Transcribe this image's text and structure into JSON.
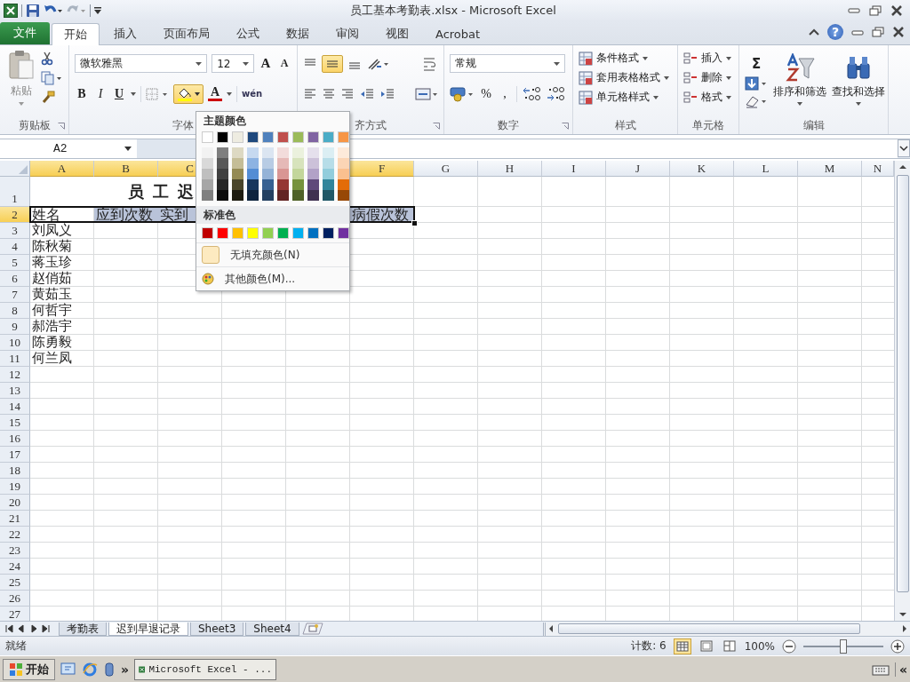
{
  "window": {
    "title": "员工基本考勤表.xlsx - Microsoft Excel",
    "help": "?"
  },
  "ribbon_tabs": [
    {
      "label": "文件",
      "kind": "file",
      "selected": false
    },
    {
      "label": "开始",
      "kind": "tab",
      "selected": true
    },
    {
      "label": "插入",
      "kind": "tab",
      "selected": false
    },
    {
      "label": "页面布局",
      "kind": "tab",
      "selected": false
    },
    {
      "label": "公式",
      "kind": "tab",
      "selected": false
    },
    {
      "label": "数据",
      "kind": "tab",
      "selected": false
    },
    {
      "label": "审阅",
      "kind": "tab",
      "selected": false
    },
    {
      "label": "视图",
      "kind": "tab",
      "selected": false
    },
    {
      "label": "Acrobat",
      "kind": "tab",
      "selected": false
    }
  ],
  "ribbon": {
    "clipboard": {
      "paste": "粘贴",
      "group": "剪贴板"
    },
    "font": {
      "name": "微软雅黑",
      "size": "12",
      "grow": "A",
      "shrink": "A",
      "bold": "B",
      "italic": "I",
      "underline": "U",
      "font_color": "A",
      "phonetic": "wén",
      "fill_pressed": true,
      "group": "字体"
    },
    "alignment": {
      "middle_pressed": true,
      "group": "齐方式"
    },
    "number": {
      "format": "常规",
      "percent": "%",
      "comma": ",",
      "group": "数字"
    },
    "styles": {
      "items": [
        "条件格式",
        "套用表格格式",
        "单元格样式"
      ],
      "group": "样式"
    },
    "cells": {
      "items": [
        "插入",
        "删除",
        "格式"
      ],
      "group": "单元格"
    },
    "editing": {
      "sum": "Σ",
      "sort": "排序和筛选",
      "find": "查找和选择",
      "group": "编辑"
    }
  },
  "name_box": "A2",
  "sheet": {
    "columns": [
      {
        "kind": "header",
        "label": "A",
        "selected": true
      },
      {
        "kind": "header",
        "label": "B",
        "selected": true
      },
      {
        "kind": "header",
        "label": "C",
        "selected": true
      },
      {
        "kind": "covered"
      },
      {
        "kind": "covered"
      },
      {
        "kind": "header",
        "label": "F",
        "selected": true
      },
      {
        "kind": "header",
        "label": "G",
        "selected": false
      },
      {
        "kind": "header",
        "label": "H",
        "selected": false
      },
      {
        "kind": "header",
        "label": "I",
        "selected": false
      },
      {
        "kind": "header",
        "label": "J",
        "selected": false
      },
      {
        "kind": "header",
        "label": "K",
        "selected": false
      },
      {
        "kind": "header",
        "label": "L",
        "selected": false
      },
      {
        "kind": "header",
        "label": "M",
        "selected": false
      },
      {
        "kind": "header",
        "label": "N",
        "selected": false
      }
    ],
    "rows": [
      {
        "number": "1",
        "selected": false,
        "kind": "title",
        "text": "员工迟"
      },
      {
        "number": "2",
        "selected": true,
        "kind": "header",
        "cells": [
          {
            "kind": "text",
            "text": "姓名",
            "highlighted": false
          },
          {
            "kind": "text",
            "text": "应到次数",
            "highlighted": true
          },
          {
            "kind": "text",
            "text": "实到",
            "highlighted": true
          },
          {
            "kind": "covered"
          },
          {
            "kind": "covered"
          },
          {
            "kind": "text",
            "text": "病假次数",
            "highlighted": true
          }
        ]
      },
      {
        "number": "3",
        "selected": false,
        "kind": "data",
        "cells": [
          {
            "kind": "text",
            "text": "刘凤义"
          }
        ]
      },
      {
        "number": "4",
        "selected": false,
        "kind": "data",
        "cells": [
          {
            "kind": "text",
            "text": "陈秋菊"
          }
        ]
      },
      {
        "number": "5",
        "selected": false,
        "kind": "data",
        "cells": [
          {
            "kind": "text",
            "text": "蒋玉珍"
          }
        ]
      },
      {
        "number": "6",
        "selected": false,
        "kind": "data",
        "cells": [
          {
            "kind": "text",
            "text": "赵俏茹"
          }
        ]
      },
      {
        "number": "7",
        "selected": false,
        "kind": "data",
        "cells": [
          {
            "kind": "text",
            "text": "黄茹玉"
          }
        ]
      },
      {
        "number": "8",
        "selected": false,
        "kind": "data",
        "cells": [
          {
            "kind": "text",
            "text": "何哲宇"
          }
        ]
      },
      {
        "number": "9",
        "selected": false,
        "kind": "data",
        "cells": [
          {
            "kind": "text",
            "text": "郝浩宇"
          }
        ]
      },
      {
        "number": "10",
        "selected": false,
        "kind": "data",
        "cells": [
          {
            "kind": "text",
            "text": "陈勇毅"
          }
        ]
      },
      {
        "number": "11",
        "selected": false,
        "kind": "data",
        "cells": [
          {
            "kind": "text",
            "text": "何兰凤"
          }
        ]
      },
      {
        "number": "12",
        "selected": false,
        "kind": "data",
        "cells": []
      },
      {
        "number": "13",
        "selected": false,
        "kind": "data",
        "cells": []
      },
      {
        "number": "14",
        "selected": false,
        "kind": "data",
        "cells": []
      },
      {
        "number": "15",
        "selected": false,
        "kind": "data",
        "cells": []
      },
      {
        "number": "16",
        "selected": false,
        "kind": "data",
        "cells": []
      },
      {
        "number": "17",
        "selected": false,
        "kind": "data",
        "cells": []
      },
      {
        "number": "18",
        "selected": false,
        "kind": "data",
        "cells": []
      },
      {
        "number": "19",
        "selected": false,
        "kind": "data",
        "cells": []
      },
      {
        "number": "20",
        "selected": false,
        "kind": "data",
        "cells": []
      },
      {
        "number": "21",
        "selected": false,
        "kind": "data",
        "cells": []
      },
      {
        "number": "22",
        "selected": false,
        "kind": "data",
        "cells": []
      },
      {
        "number": "23",
        "selected": false,
        "kind": "data",
        "cells": []
      },
      {
        "number": "24",
        "selected": false,
        "kind": "data",
        "cells": []
      },
      {
        "number": "25",
        "selected": false,
        "kind": "data",
        "cells": []
      },
      {
        "number": "26",
        "selected": false,
        "kind": "data",
        "cells": []
      },
      {
        "number": "27",
        "selected": false,
        "kind": "data",
        "cells": []
      }
    ]
  },
  "fill_menu": {
    "theme_header": "主题颜色",
    "theme": [
      {
        "color": "#ffffff",
        "shades": [
          {
            "color": "#f2f2f2"
          },
          {
            "color": "#d9d9d9"
          },
          {
            "color": "#bfbfbf"
          },
          {
            "color": "#a6a6a6"
          },
          {
            "color": "#808080"
          }
        ]
      },
      {
        "color": "#000000",
        "shades": [
          {
            "color": "#7f7f7f"
          },
          {
            "color": "#595959"
          },
          {
            "color": "#404040"
          },
          {
            "color": "#262626"
          },
          {
            "color": "#0d0d0d"
          }
        ]
      },
      {
        "color": "#eeece1",
        "shades": [
          {
            "color": "#ddd9c3"
          },
          {
            "color": "#c4bd97"
          },
          {
            "color": "#948a54"
          },
          {
            "color": "#4a452a"
          },
          {
            "color": "#1e1c11"
          }
        ]
      },
      {
        "color": "#1f497d",
        "shades": [
          {
            "color": "#c6d9f0"
          },
          {
            "color": "#8db3e2"
          },
          {
            "color": "#548dd4"
          },
          {
            "color": "#17365d"
          },
          {
            "color": "#0f243e"
          }
        ]
      },
      {
        "color": "#4f81bd",
        "shades": [
          {
            "color": "#dbe5f1"
          },
          {
            "color": "#b8cce4"
          },
          {
            "color": "#95b3d7"
          },
          {
            "color": "#366092"
          },
          {
            "color": "#244061"
          }
        ]
      },
      {
        "color": "#c0504d",
        "shades": [
          {
            "color": "#f2dcdb"
          },
          {
            "color": "#e5b9b7"
          },
          {
            "color": "#d99694"
          },
          {
            "color": "#953734"
          },
          {
            "color": "#632423"
          }
        ]
      },
      {
        "color": "#9bbb59",
        "shades": [
          {
            "color": "#ebf1dd"
          },
          {
            "color": "#d7e3bc"
          },
          {
            "color": "#c3d69b"
          },
          {
            "color": "#76923c"
          },
          {
            "color": "#4f6128"
          }
        ]
      },
      {
        "color": "#8064a2",
        "shades": [
          {
            "color": "#e5e0ec"
          },
          {
            "color": "#ccc1d9"
          },
          {
            "color": "#b2a2c7"
          },
          {
            "color": "#5f497a"
          },
          {
            "color": "#3f3151"
          }
        ]
      },
      {
        "color": "#4bacc6",
        "shades": [
          {
            "color": "#dbeef3"
          },
          {
            "color": "#b7dde8"
          },
          {
            "color": "#92cddc"
          },
          {
            "color": "#31859b"
          },
          {
            "color": "#205867"
          }
        ]
      },
      {
        "color": "#f79646",
        "shades": [
          {
            "color": "#fdeada"
          },
          {
            "color": "#fbd5b5"
          },
          {
            "color": "#fac08f"
          },
          {
            "color": "#e36c09"
          },
          {
            "color": "#974806"
          }
        ]
      }
    ],
    "standard_header": "标准色",
    "standard": [
      {
        "color": "#c00000"
      },
      {
        "color": "#ff0000"
      },
      {
        "color": "#ffc000"
      },
      {
        "color": "#ffff00"
      },
      {
        "color": "#92d050"
      },
      {
        "color": "#00b050"
      },
      {
        "color": "#00b0f0"
      },
      {
        "color": "#0070c0"
      },
      {
        "color": "#002060"
      },
      {
        "color": "#7030a0"
      }
    ],
    "no_fill": "无填充颜色(N)",
    "more": "其他颜色(M)..."
  },
  "sheet_tabs": [
    {
      "label": "考勤表",
      "selected": false
    },
    {
      "label": "迟到早退记录",
      "selected": true
    },
    {
      "label": "Sheet3",
      "selected": false
    },
    {
      "label": "Sheet4",
      "selected": false
    }
  ],
  "status_bar": {
    "ready": "就绪",
    "count": "计数: 6",
    "zoom": "100%",
    "level": 0.5
  },
  "taskbar": {
    "start": "开始",
    "more": "»",
    "window": "Microsoft Excel - ...",
    "collapse": "«"
  }
}
